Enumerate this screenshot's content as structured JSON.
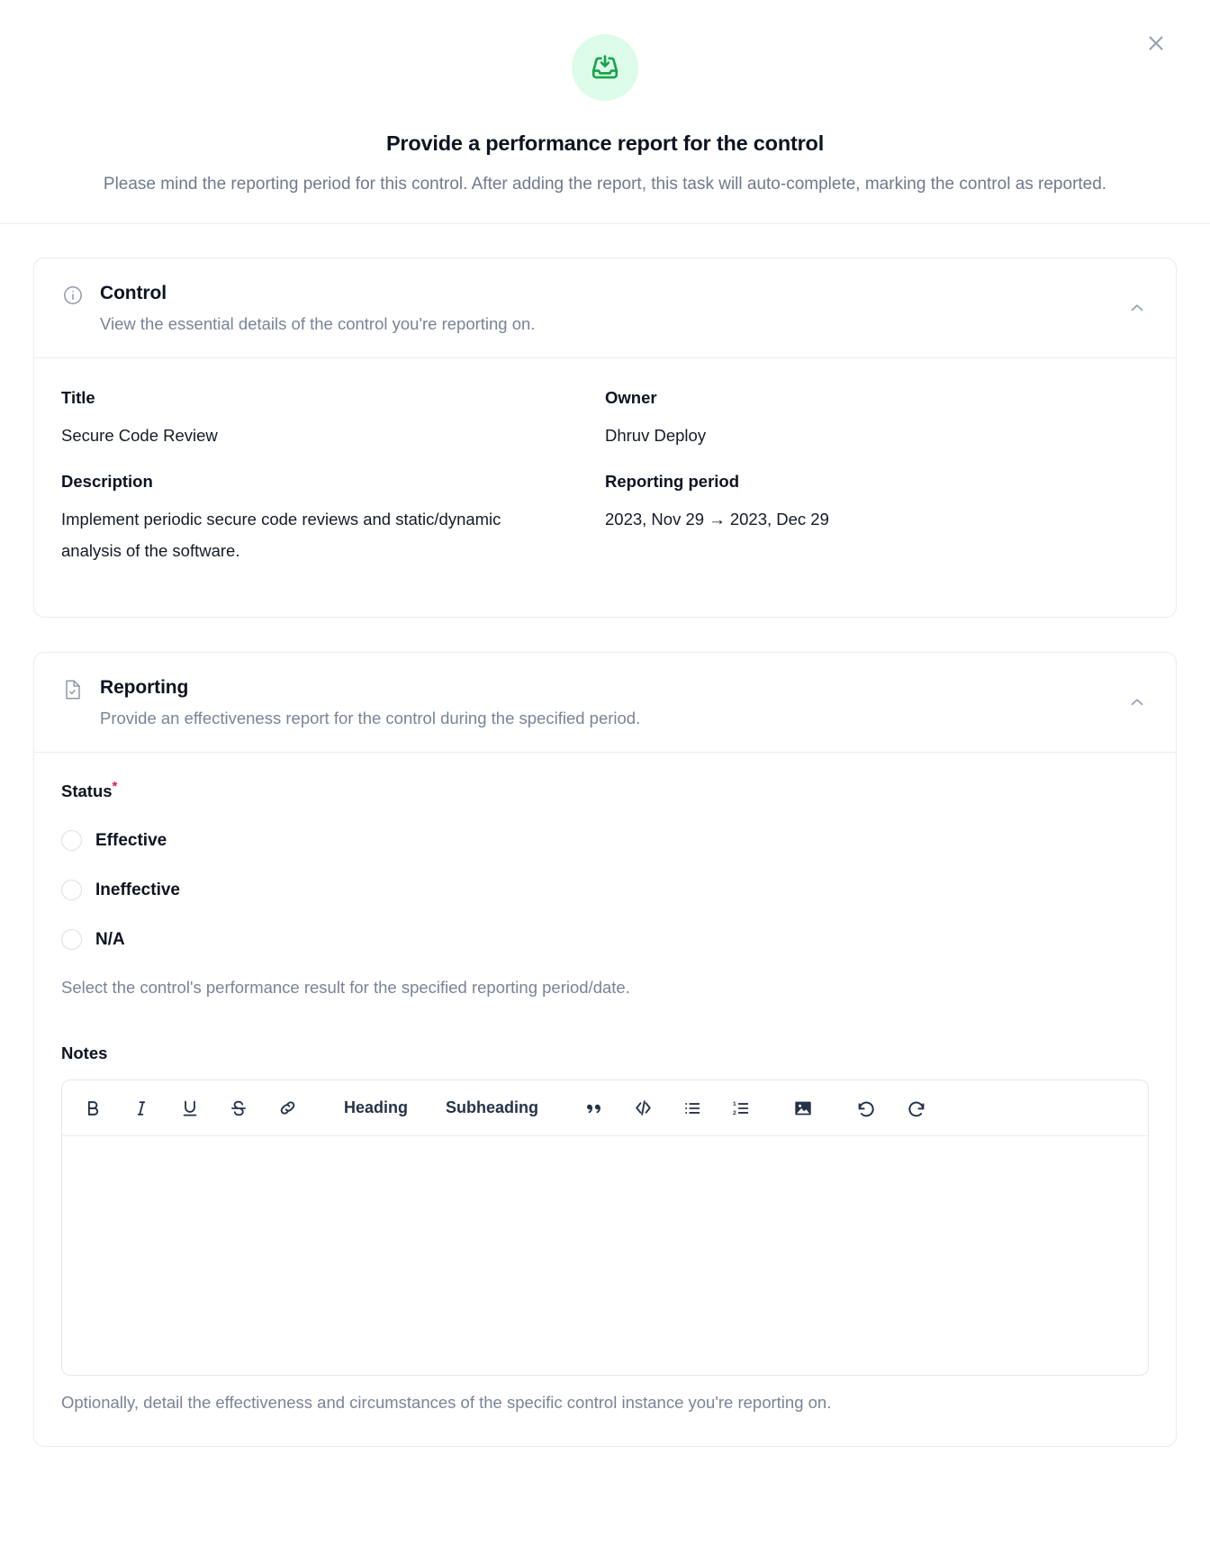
{
  "header": {
    "icon": "inbox-download-icon",
    "icon_bg": "#dcfce9",
    "icon_color": "#1aa34a",
    "title": "Provide a performance report for the control",
    "subtitle": "Please mind the reporting period for this control. After adding the report, this task will auto-complete, marking the control as reported.",
    "close_icon": "close-icon"
  },
  "control_card": {
    "icon": "info-circle-icon",
    "title": "Control",
    "subtitle": "View the essential details of the control you're reporting on.",
    "collapse_icon": "chevron-up-icon",
    "fields": [
      {
        "label": "Title",
        "value": "Secure Code Review"
      },
      {
        "label": "Owner",
        "value": "Dhruv Deploy"
      },
      {
        "label": "Description",
        "value": "Implement periodic secure code reviews and static/dynamic analysis of the software."
      },
      {
        "label": "Reporting period",
        "value": "2023, Nov 29 → 2023, Dec 29"
      }
    ]
  },
  "reporting_card": {
    "icon": "file-check-icon",
    "title": "Reporting",
    "subtitle": "Provide an effectiveness report for the control during the specified period.",
    "collapse_icon": "chevron-up-icon",
    "status": {
      "label": "Status",
      "required_mark": "*",
      "required_color": "#e8174a",
      "options": [
        {
          "label": "Effective",
          "selected": false
        },
        {
          "label": "Ineffective",
          "selected": false
        },
        {
          "label": "N/A",
          "selected": false
        }
      ],
      "help": "Select the control's performance result for the specified reporting period/date."
    },
    "notes": {
      "label": "Notes",
      "value": "",
      "placeholder": "",
      "help": "Optionally, detail the effectiveness and circumstances of the specific control instance you're reporting on.",
      "toolbar": [
        {
          "name": "bold-icon",
          "label": "B",
          "type": "icon"
        },
        {
          "name": "italic-icon",
          "label": "I",
          "type": "icon"
        },
        {
          "name": "underline-icon",
          "label": "U",
          "type": "icon"
        },
        {
          "name": "strikethrough-icon",
          "label": "S",
          "type": "icon"
        },
        {
          "name": "link-icon",
          "label": "",
          "type": "icon"
        },
        {
          "name": "heading-button",
          "label": "Heading",
          "type": "text"
        },
        {
          "name": "subheading-button",
          "label": "Subheading",
          "type": "text"
        },
        {
          "name": "blockquote-icon",
          "label": "",
          "type": "icon"
        },
        {
          "name": "code-block-icon",
          "label": "",
          "type": "icon"
        },
        {
          "name": "bullet-list-icon",
          "label": "",
          "type": "icon"
        },
        {
          "name": "numbered-list-icon",
          "label": "",
          "type": "icon"
        },
        {
          "name": "image-icon",
          "label": "",
          "type": "icon"
        },
        {
          "name": "undo-icon",
          "label": "",
          "type": "icon"
        },
        {
          "name": "redo-icon",
          "label": "",
          "type": "icon"
        }
      ]
    }
  }
}
